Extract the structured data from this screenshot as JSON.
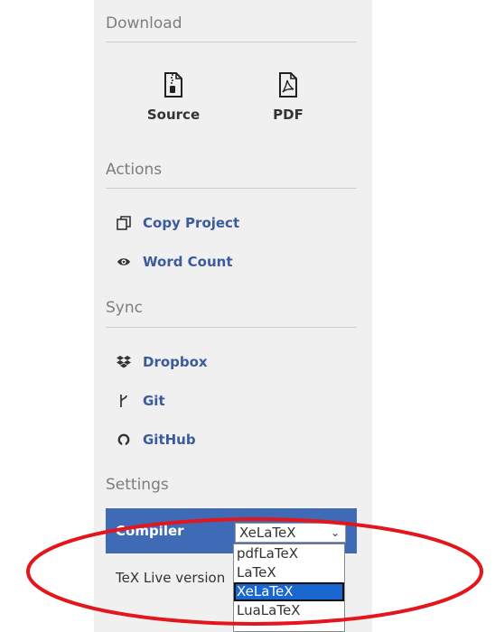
{
  "sections": {
    "download": "Download",
    "actions": "Actions",
    "sync": "Sync",
    "settings": "Settings"
  },
  "download": {
    "source_label": "Source",
    "pdf_label": "PDF"
  },
  "actions": {
    "copy_project": "Copy Project",
    "word_count": "Word Count"
  },
  "sync": {
    "dropbox": "Dropbox",
    "git": "Git",
    "github": "GitHub"
  },
  "settings": {
    "compiler_label": "Compiler",
    "compiler_value": "XeLaTeX",
    "texlive_label": "TeX Live version",
    "compiler_options": [
      "pdfLaTeX",
      "LaTeX",
      "XeLaTeX",
      "LuaLaTeX"
    ]
  },
  "colors": {
    "link": "#3b5b9e",
    "compiler_row_bg": "#3f6ab6",
    "selected_option_bg": "#1a67d2",
    "annotation": "#e4151b"
  }
}
